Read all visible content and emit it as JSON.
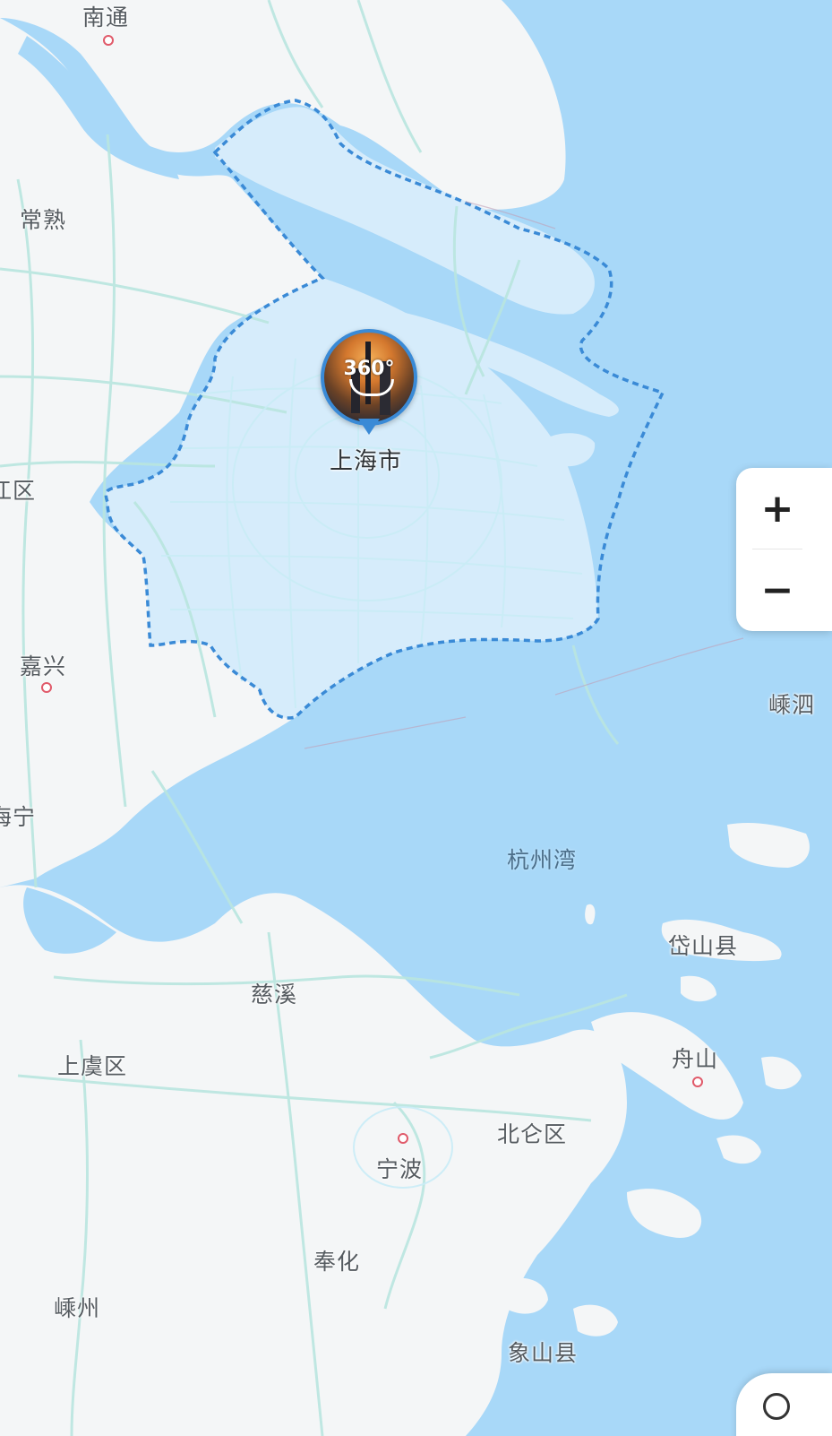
{
  "map": {
    "focus_region": "上海市",
    "panorama_badge": "360°",
    "place_labels": [
      {
        "id": "nantong",
        "text": "南通"
      },
      {
        "id": "changshu",
        "text": "常熟"
      },
      {
        "id": "wujiang",
        "text": "江区"
      },
      {
        "id": "jiaxing",
        "text": "嘉兴"
      },
      {
        "id": "haining",
        "text": "海宁"
      },
      {
        "id": "cixi",
        "text": "慈溪"
      },
      {
        "id": "shangyu",
        "text": "上虞区"
      },
      {
        "id": "ningbo",
        "text": "宁波"
      },
      {
        "id": "beilun",
        "text": "北仑区"
      },
      {
        "id": "fenghua",
        "text": "奉化"
      },
      {
        "id": "shengzhou",
        "text": "嵊州"
      },
      {
        "id": "xiangshan",
        "text": "象山县"
      },
      {
        "id": "zhoushan",
        "text": "舟山"
      },
      {
        "id": "daishan",
        "text": "岱山县"
      },
      {
        "id": "shengsi",
        "text": "嵊泗"
      }
    ],
    "water_labels": [
      {
        "id": "hangzhou-bay",
        "text": "杭州湾"
      }
    ],
    "colors": {
      "sea": "#a8d8f8",
      "land": "#f4f6f7",
      "road": "#b9e6df",
      "highlight_fill": "#d6ecfb",
      "boundary": "#3a8ad6",
      "city_dot": "#e05a6a"
    }
  },
  "controls": {
    "zoom_in": "+",
    "zoom_out": "−"
  }
}
